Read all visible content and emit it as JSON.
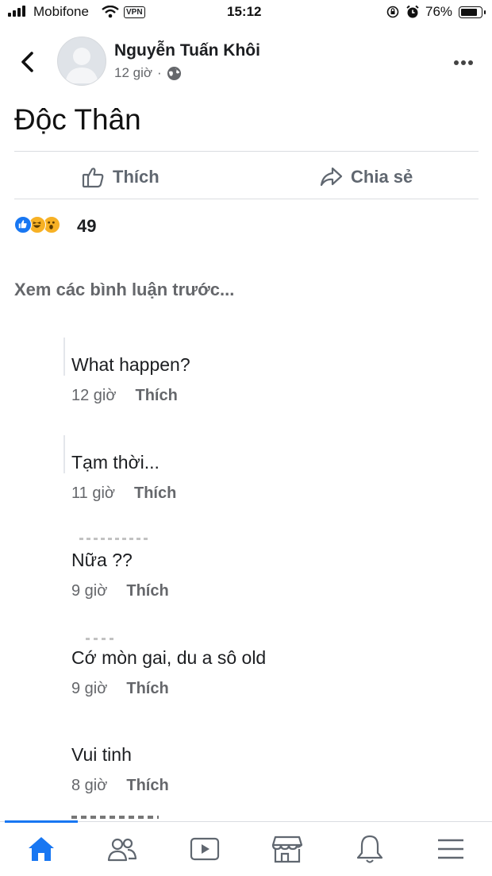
{
  "status_bar": {
    "carrier": "Mobifone",
    "vpn": "VPN",
    "time": "15:12",
    "battery": "76%"
  },
  "post": {
    "author": "Nguyễn Tuấn Khôi",
    "time": "12 giờ",
    "dot": "·",
    "text": "Độc Thân",
    "actions": {
      "like": "Thích",
      "share": "Chia sẻ"
    },
    "reaction_count": "49"
  },
  "comments_section": {
    "view_previous": "Xem các bình luận trước...",
    "comments": [
      {
        "text": "What happen?",
        "time": "12 giờ",
        "like": "Thích"
      },
      {
        "text": "Tạm thời...",
        "time": "11 giờ",
        "like": "Thích"
      },
      {
        "text": "Nữa ??",
        "time": "9 giờ",
        "like": "Thích"
      },
      {
        "text": "Cớ mòn gai, du a sô old",
        "time": "9 giờ",
        "like": "Thích"
      },
      {
        "text": "Vui tinh",
        "time": "8 giờ",
        "like": "Thích"
      }
    ]
  },
  "colors": {
    "accent": "#1877f2",
    "gray": "#65676b",
    "divider": "#dadde1"
  },
  "icons": [
    "back-icon",
    "more-icon",
    "like-icon",
    "share-icon",
    "globe-icon",
    "home-icon",
    "friends-icon",
    "watch-icon",
    "marketplace-icon",
    "bell-icon",
    "menu-icon"
  ]
}
